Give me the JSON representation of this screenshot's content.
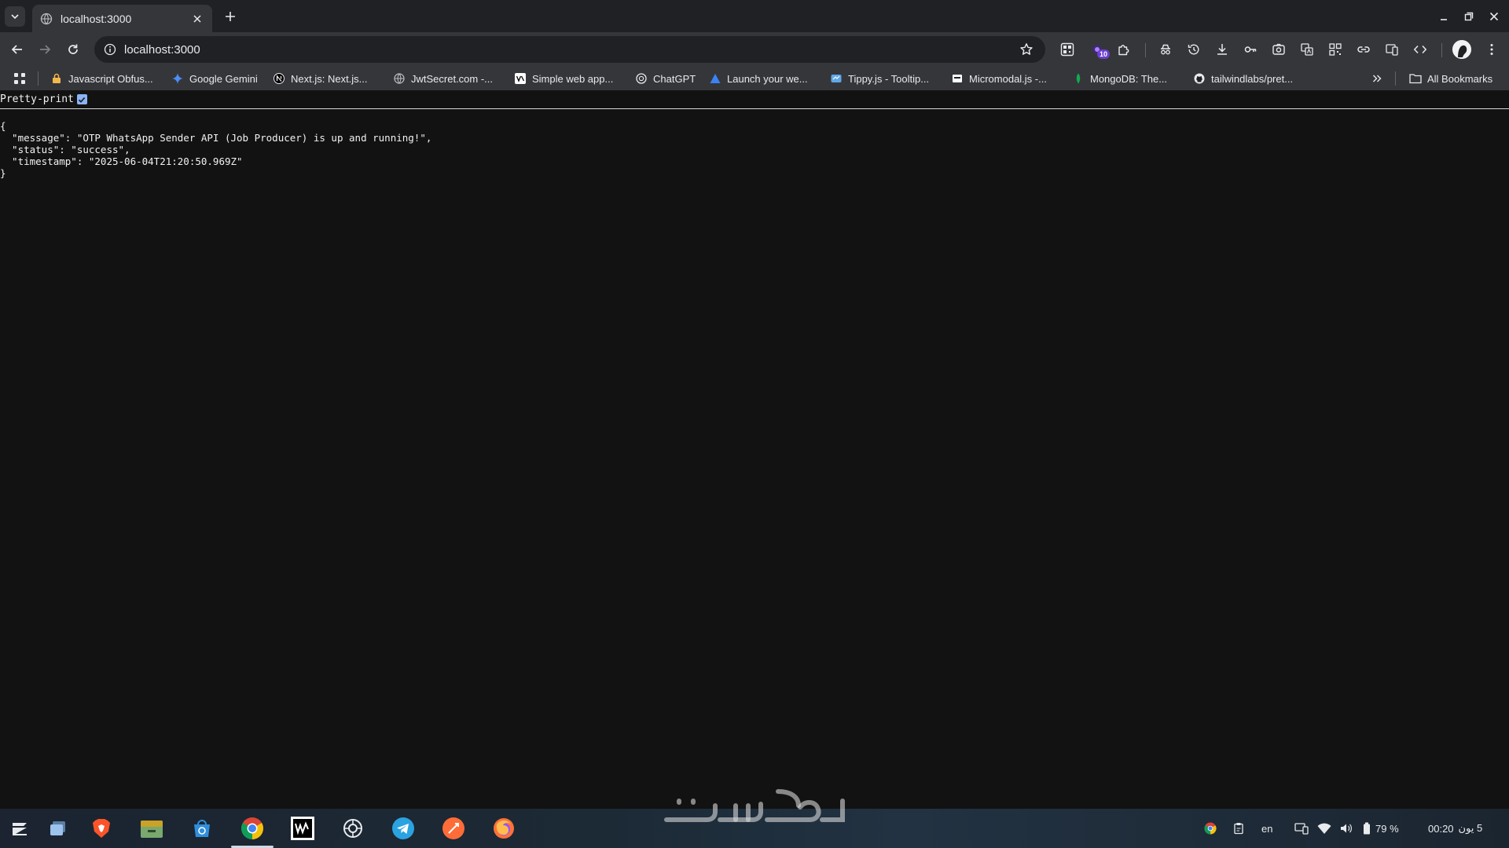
{
  "browser": {
    "tab": {
      "title": "localhost:3000"
    },
    "address_bar": {
      "url": "localhost:3000"
    },
    "extension_badge": "10",
    "bookmarks": [
      {
        "label": "Javascript Obfus...",
        "icon": "lock-icon"
      },
      {
        "label": "Google Gemini",
        "icon": "gemini-icon"
      },
      {
        "label": "Next.js: Next.js...",
        "icon": "nextjs-icon"
      },
      {
        "label": "JwtSecret.com -...",
        "icon": "globe-icon"
      },
      {
        "label": "Simple web app...",
        "icon": "vercel-icon"
      },
      {
        "label": "ChatGPT",
        "icon": "chatgpt-icon"
      },
      {
        "label": "Launch your we...",
        "icon": "triangle-icon"
      },
      {
        "label": "Tippy.js - Tooltip...",
        "icon": "tippy-icon"
      },
      {
        "label": "Micromodal.js -...",
        "icon": "modal-icon"
      },
      {
        "label": "MongoDB: The...",
        "icon": "mongodb-leaf-icon"
      },
      {
        "label": "tailwindlabs/pret...",
        "icon": "github-icon"
      }
    ],
    "all_bookmarks_label": "All Bookmarks"
  },
  "page": {
    "pretty_print_label": "Pretty-print",
    "pretty_print_checked": true,
    "json_lines": [
      "{",
      "  \"message\": \"OTP WhatsApp Sender API (Job Producer) is up and running!\",",
      "  \"status\": \"success\",",
      "  \"timestamp\": \"2025-06-04T21:20:50.969Z\"",
      "}"
    ]
  },
  "taskbar": {
    "apps": [
      "zorin-menu-icon",
      "files-icon",
      "brave-icon",
      "file-manager-icon",
      "store-icon",
      "chrome-icon",
      "webstorm-icon",
      "chatgpt-icon",
      "telegram-icon",
      "postman-icon",
      "firefox-icon"
    ],
    "tray": {
      "language": "en",
      "battery": "79 %",
      "time": "00:20",
      "date": "5 يون"
    }
  },
  "colors": {
    "page_bg": "#121212",
    "toolbar_bg": "#35363a",
    "tabstrip_bg": "#202124",
    "checkbox": "#8ab4f8"
  }
}
